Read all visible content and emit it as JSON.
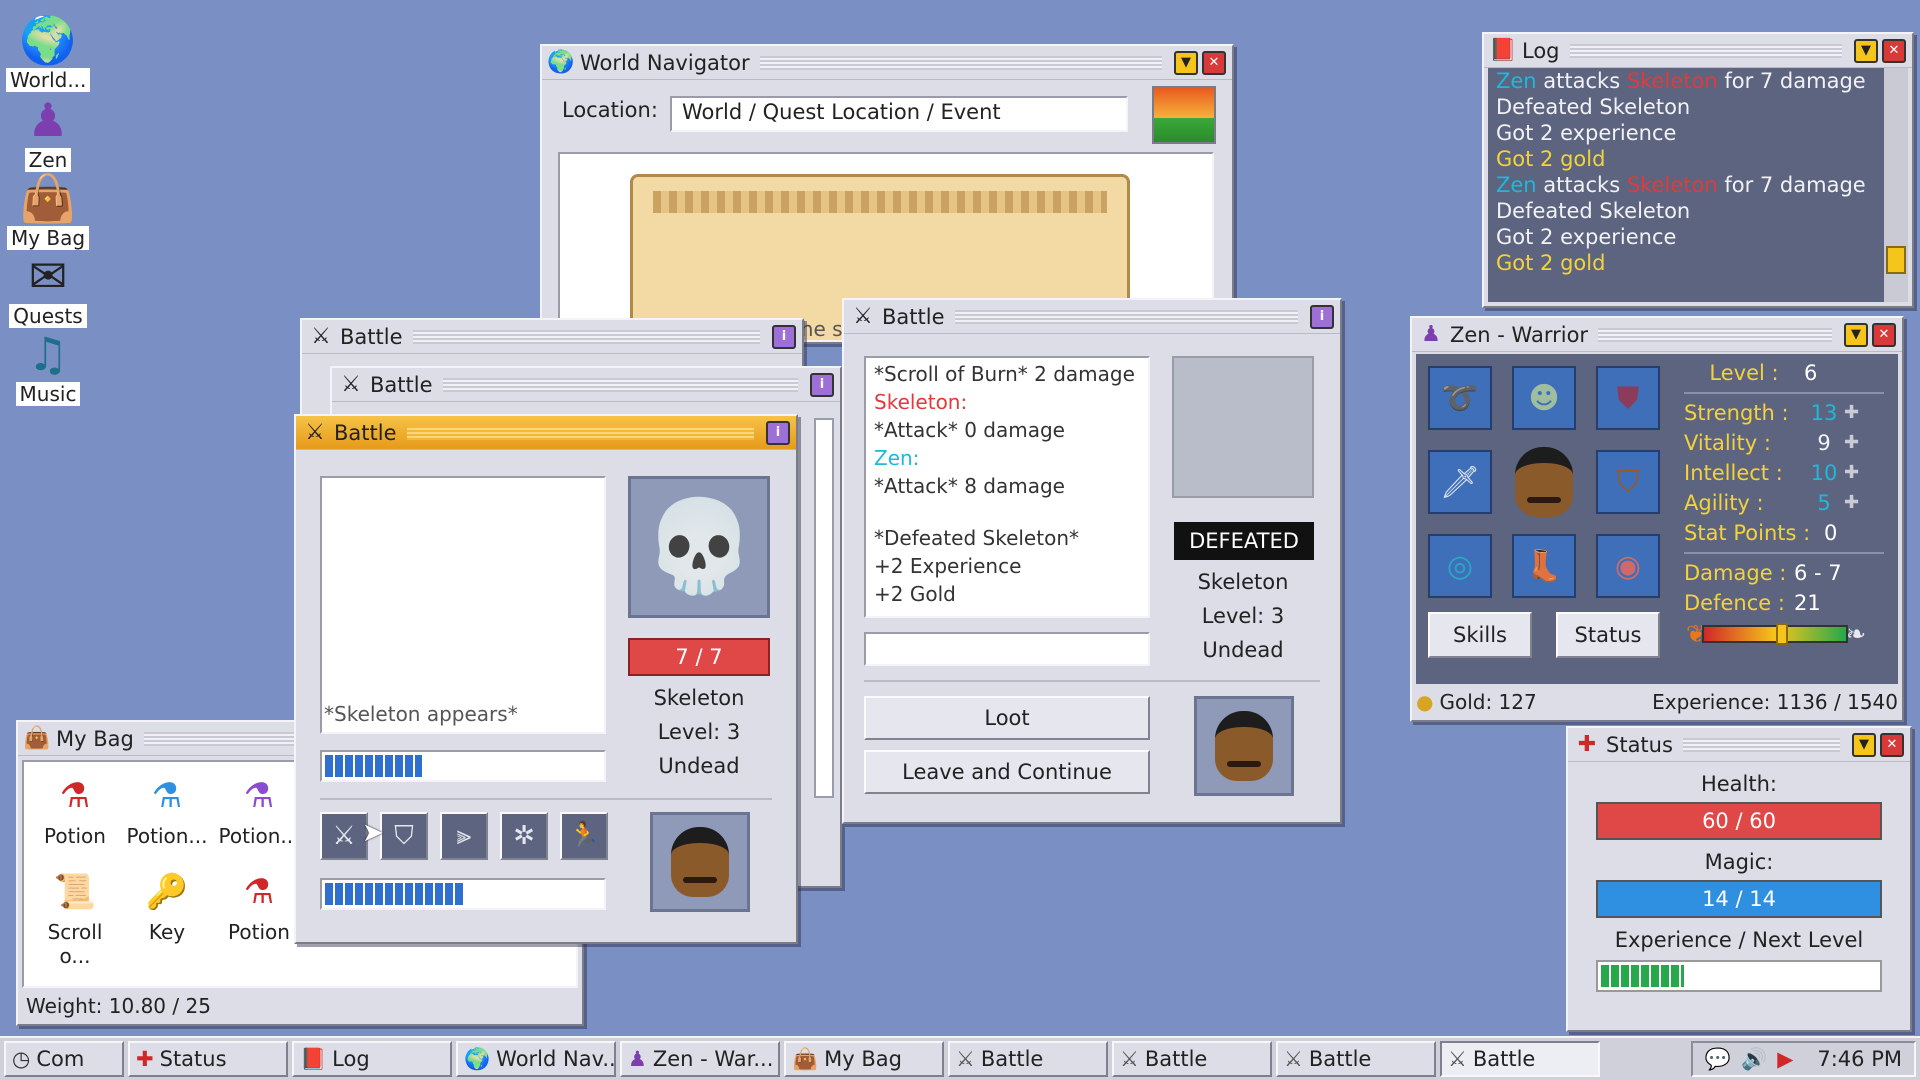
{
  "desktop": {
    "icons": [
      {
        "label": "World...",
        "icon": "globe-icon"
      },
      {
        "label": "Zen",
        "icon": "mage-icon"
      },
      {
        "label": "My Bag",
        "icon": "bag-icon"
      },
      {
        "label": "Quests",
        "icon": "envelope-icon"
      },
      {
        "label": "Music",
        "icon": "music-note-icon"
      }
    ]
  },
  "world_navigator": {
    "title": "World Navigator",
    "location_label": "Location:",
    "location_value": "World / Quest Location / Event",
    "scroll_partial_text": "You attack the s"
  },
  "log": {
    "title": "Log",
    "lines": [
      {
        "parts": [
          {
            "t": "Zen",
            "c": "cyan"
          },
          {
            "t": " attacks ",
            "c": "white"
          },
          {
            "t": "Skeleton",
            "c": "red"
          },
          {
            "t": " for 7 damage",
            "c": "white"
          }
        ]
      },
      {
        "parts": [
          {
            "t": "Defeated Skeleton",
            "c": "white"
          }
        ]
      },
      {
        "parts": [
          {
            "t": "Got 2 experience",
            "c": "white"
          }
        ]
      },
      {
        "parts": [
          {
            "t": "Got 2 gold",
            "c": "yellow"
          }
        ]
      },
      {
        "parts": [
          {
            "t": "Zen",
            "c": "cyan"
          },
          {
            "t": " attacks ",
            "c": "white"
          },
          {
            "t": "Skeleton",
            "c": "red"
          },
          {
            "t": " for 7 damage",
            "c": "white"
          }
        ]
      },
      {
        "parts": [
          {
            "t": "Defeated Skeleton",
            "c": "white"
          }
        ]
      },
      {
        "parts": [
          {
            "t": "Got 2 experience",
            "c": "white"
          }
        ]
      },
      {
        "parts": [
          {
            "t": "Got 2 gold",
            "c": "yellow"
          }
        ]
      }
    ]
  },
  "battle_result": {
    "title": "Battle",
    "log": [
      {
        "t": "*Scroll of Burn* 2 damage",
        "c": "dark"
      },
      {
        "t": "Skeleton:",
        "c": "red"
      },
      {
        "t": "*Attack* 0 damage",
        "c": "dark"
      },
      {
        "t": "Zen:",
        "c": "cyan"
      },
      {
        "t": "*Attack* 8 damage",
        "c": "dark"
      },
      {
        "t": "",
        "c": "dark"
      },
      {
        "t": "*Defeated Skeleton*",
        "c": "dark"
      },
      {
        "t": "+2 Experience",
        "c": "dark"
      },
      {
        "t": "+2 Gold",
        "c": "dark"
      }
    ],
    "status_badge": "DEFEATED",
    "enemy_name": "Skeleton",
    "enemy_level": "Level: 3",
    "enemy_type": "Undead",
    "loot_label": "Loot",
    "leave_label": "Leave and Continue"
  },
  "battle_back1": {
    "title": "Battle"
  },
  "battle_back2": {
    "title": "Battle"
  },
  "battle_active": {
    "title": "Battle",
    "log_text": "*Skeleton appears*",
    "enemy_hp": "7 / 7",
    "enemy_name": "Skeleton",
    "enemy_level": "Level: 3",
    "enemy_type": "Undead",
    "player_bar_fraction": 0.35,
    "action_bar_fraction": 0.5,
    "actions": [
      {
        "name": "attack-action-button",
        "icon": "crossed-swords-icon"
      },
      {
        "name": "defend-action-button",
        "icon": "shield-icon"
      },
      {
        "name": "skills-action-button",
        "icon": "sliders-icon"
      },
      {
        "name": "item-action-button",
        "icon": "bug-icon"
      },
      {
        "name": "flee-action-button",
        "icon": "running-man-icon"
      }
    ]
  },
  "character": {
    "title": "Zen - Warrior",
    "level_label": "Level :",
    "level_value": "6",
    "stats": [
      {
        "label": "Strength :",
        "value": "13",
        "c": "cyan"
      },
      {
        "label": "Vitality :",
        "value": "9",
        "c": "white"
      },
      {
        "label": "Intellect :",
        "value": "10",
        "c": "cyan"
      },
      {
        "label": "Agility :",
        "value": "5",
        "c": "cyan"
      }
    ],
    "stat_points_label": "Stat Points :",
    "stat_points_value": "0",
    "damage_label": "Damage :",
    "damage_value": "6 - 7",
    "defence_label": "Defence :",
    "defence_value": "21",
    "skills_label": "Skills",
    "status_label": "Status",
    "gold": "Gold: 127",
    "experience": "Experience: 1136 / 1540",
    "alignment_fraction": 0.55
  },
  "bag": {
    "title": "My Bag",
    "items": [
      {
        "label": "Potion",
        "icon": "red-potion-icon"
      },
      {
        "label": "Potion...",
        "icon": "blue-potion-icon"
      },
      {
        "label": "Potion...",
        "icon": "purple-potion-icon"
      },
      {
        "label": "Scroll o...",
        "icon": "scroll-icon"
      },
      {
        "label": "Key",
        "icon": "key-icon"
      },
      {
        "label": "Potion",
        "icon": "red-potion-icon"
      }
    ],
    "weight": "Weight: 10.80 / 25"
  },
  "status": {
    "title": "Status",
    "health_label": "Health:",
    "health_value": "60 / 60",
    "health_fraction": 1.0,
    "magic_label": "Magic:",
    "magic_value": "14 / 14",
    "magic_fraction": 1.0,
    "exp_label": "Experience / Next Level",
    "exp_fraction": 0.3
  },
  "taskbar": {
    "items": [
      {
        "label": "Com",
        "icon": "clock-icon"
      },
      {
        "label": "Status",
        "icon": "red-cross-icon"
      },
      {
        "label": "Log",
        "icon": "book-icon"
      },
      {
        "label": "World Nav...",
        "icon": "globe-icon"
      },
      {
        "label": "Zen - War...",
        "icon": "mage-icon"
      },
      {
        "label": "My Bag",
        "icon": "bag-icon"
      },
      {
        "label": "Battle",
        "icon": "crossed-swords-icon"
      },
      {
        "label": "Battle",
        "icon": "crossed-swords-icon"
      },
      {
        "label": "Battle",
        "icon": "crossed-swords-icon"
      },
      {
        "label": "Battle",
        "icon": "crossed-swords-icon"
      }
    ],
    "time": "7:46 PM"
  },
  "colors": {
    "desktop": "#7a90c4",
    "health": "#e04848",
    "magic": "#2f8fe0",
    "experience": "#27a84a",
    "active_title": "#f2b030"
  }
}
